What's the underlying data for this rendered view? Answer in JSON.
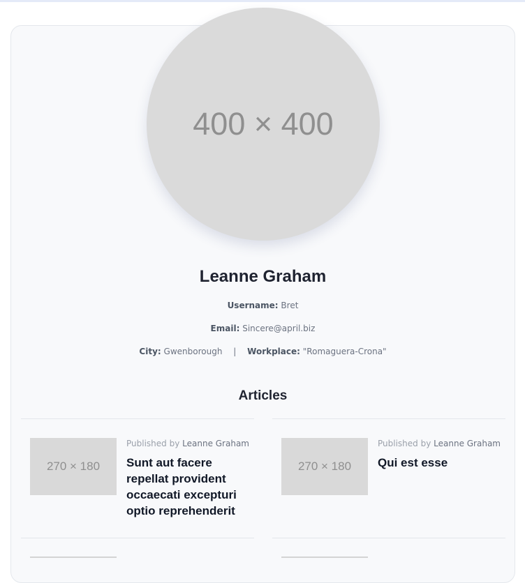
{
  "profile": {
    "avatar_placeholder": "400 × 400",
    "name": "Leanne Graham",
    "username_label": "Username:",
    "username": "Bret",
    "email_label": "Email:",
    "email": "Sincere@april.biz",
    "city_label": "City:",
    "city": "Gwenborough",
    "separator": "|",
    "workplace_label": "Workplace:",
    "workplace": "\"Romaguera-Crona\""
  },
  "articles": {
    "heading": "Articles",
    "items": [
      {
        "thumb": "270 × 180",
        "byline_prefix": "Published by",
        "author": "Leanne Graham",
        "title": "Sunt aut facere repellat provident occaecati excepturi optio reprehenderit"
      },
      {
        "thumb": "270 × 180",
        "byline_prefix": "Published by",
        "author": "Leanne Graham",
        "title": "Qui est esse"
      }
    ]
  }
}
